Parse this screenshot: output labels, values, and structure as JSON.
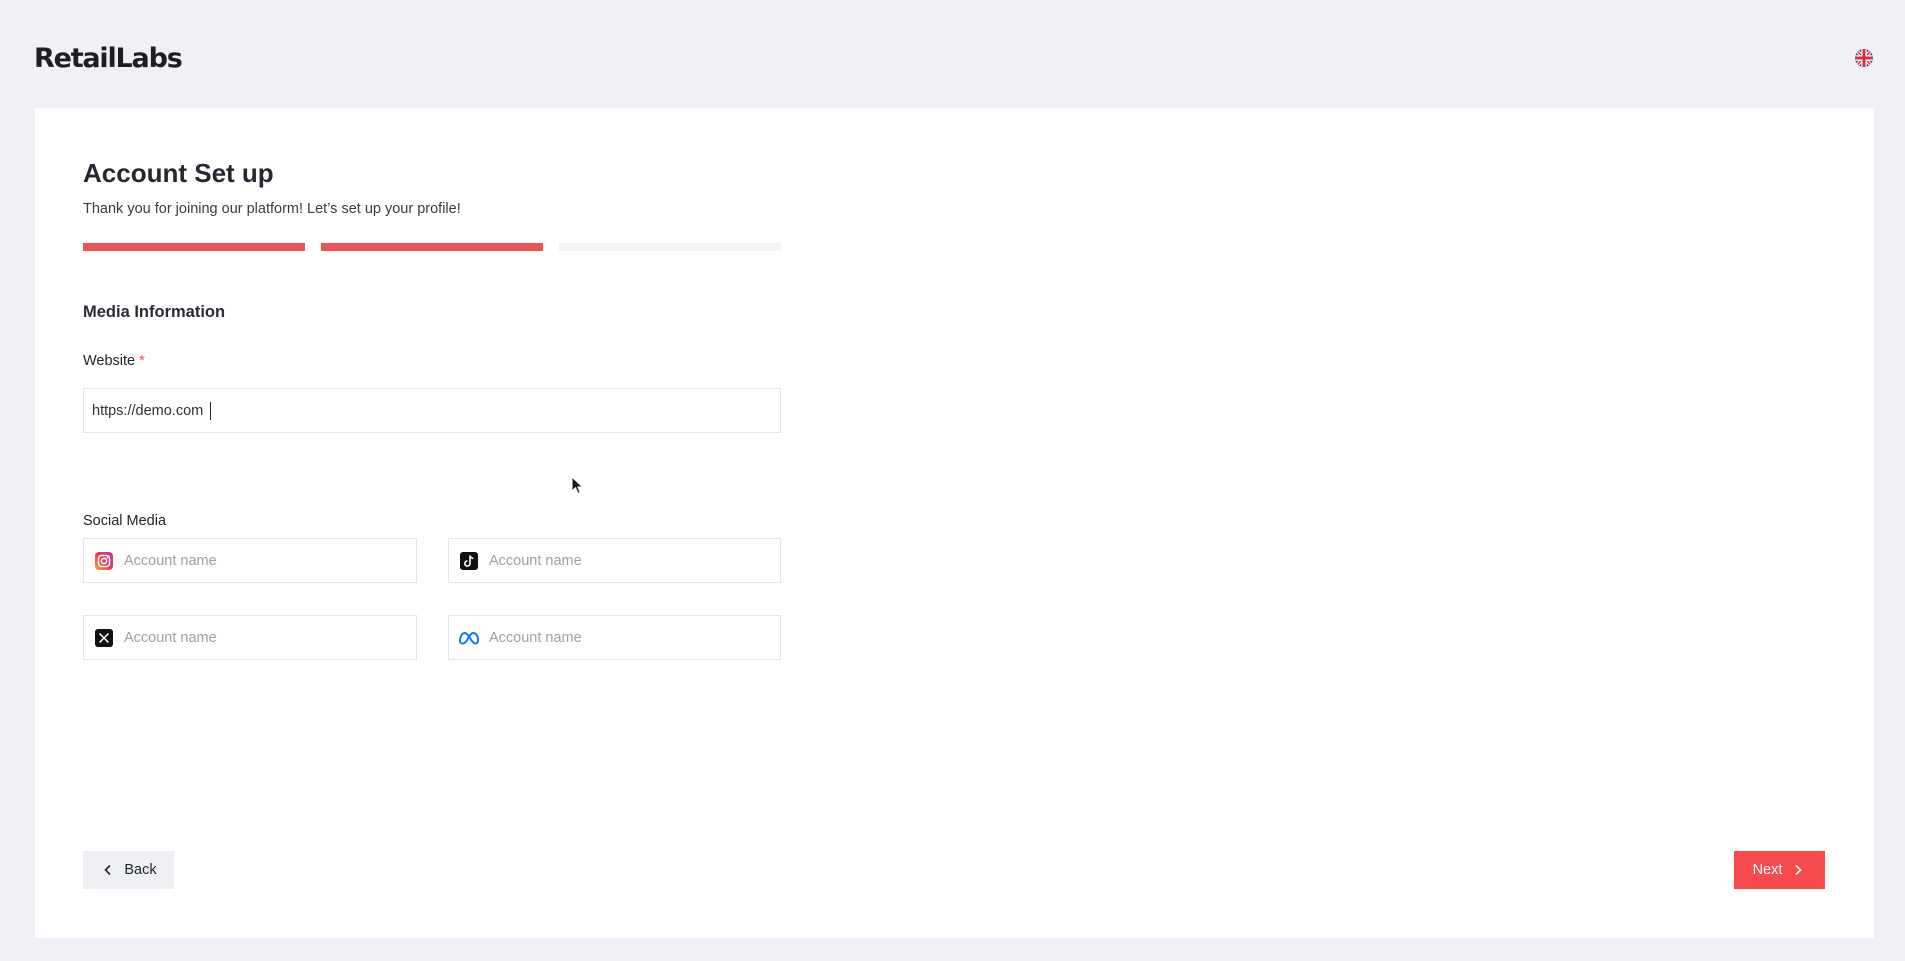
{
  "header": {
    "logo_text": "RetailLabs",
    "language_icon": "uk-flag-icon"
  },
  "main": {
    "title": "Account Set up",
    "subtitle": "Thank you for joining our platform! Let’s set up your profile!",
    "progress": {
      "total_steps": 3,
      "completed_steps": 2,
      "done_color": "#ef5254",
      "todo_color": "#f3f3f5"
    },
    "section_title": "Media Information",
    "website": {
      "label": "Website",
      "required_mark": "*",
      "value": "https://demo.com"
    },
    "social": {
      "label": "Social Media",
      "fields": [
        {
          "icon": "instagram-icon",
          "placeholder": "Account name",
          "value": ""
        },
        {
          "icon": "tiktok-icon",
          "placeholder": "Account name",
          "value": ""
        },
        {
          "icon": "x-twitter-icon",
          "placeholder": "Account name",
          "value": ""
        },
        {
          "icon": "meta-icon",
          "placeholder": "Account name",
          "value": ""
        }
      ]
    },
    "buttons": {
      "back_label": "Back",
      "next_label": "Next",
      "next_color": "#f64a4c"
    }
  }
}
